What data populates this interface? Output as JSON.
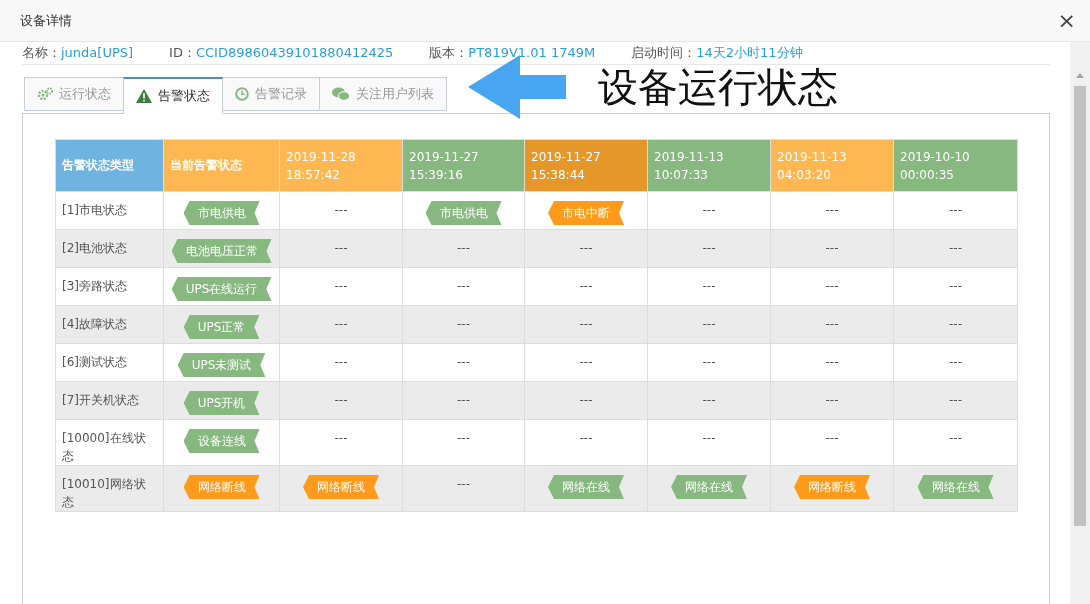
{
  "window": {
    "title": "设备详情",
    "close": "×"
  },
  "info": [
    {
      "label": "名称：",
      "value": "junda[UPS]"
    },
    {
      "label": "ID：",
      "value": "CCID89860439101880412425"
    },
    {
      "label": "版本：",
      "value": "PT819V1.01 1749M"
    },
    {
      "label": "启动时间：",
      "value": "14天2小时11分钟"
    }
  ],
  "tabs": [
    {
      "label": "运行状态",
      "selected": false
    },
    {
      "label": "告警状态",
      "selected": true
    },
    {
      "label": "告警记录",
      "selected": false
    },
    {
      "label": "关注用户列表",
      "selected": false
    }
  ],
  "annotation": {
    "text": "设备运行状态"
  },
  "table": {
    "columns": [
      {
        "label": "告警状态类型",
        "color": "#6fb3e0"
      },
      {
        "label": "当前告警状态",
        "color": "#ffb752"
      },
      {
        "label": "2019-11-28 18:57:42",
        "color": "#ffb752"
      },
      {
        "label": "2019-11-27 15:39:16",
        "color": "#87b87f"
      },
      {
        "label": "2019-11-27 15:38:44",
        "color": "#e59729"
      },
      {
        "label": "2019-11-13 10:07:33",
        "color": "#87b87f"
      },
      {
        "label": "2019-11-13 04:03:20",
        "color": "#ffb752"
      },
      {
        "label": "2019-10-10 00:00:35",
        "color": "#87b87f"
      }
    ],
    "rows": [
      {
        "cells": [
          {
            "kind": "label",
            "text": "[1]市电状态"
          },
          {
            "kind": "tag",
            "text": "市电供电",
            "color": "#87b87f"
          },
          {
            "kind": "text",
            "text": "---"
          },
          {
            "kind": "tag",
            "text": "市电供电",
            "color": "#87b87f"
          },
          {
            "kind": "tag",
            "text": "市电中断",
            "color": "#ff9a1a"
          },
          {
            "kind": "text",
            "text": "---"
          },
          {
            "kind": "text",
            "text": "---"
          },
          {
            "kind": "text",
            "text": "---"
          }
        ]
      },
      {
        "cells": [
          {
            "kind": "label",
            "text": "[2]电池状态"
          },
          {
            "kind": "tag",
            "text": "电池电压正常",
            "color": "#87b87f"
          },
          {
            "kind": "text",
            "text": "---"
          },
          {
            "kind": "text",
            "text": "---"
          },
          {
            "kind": "text",
            "text": "---"
          },
          {
            "kind": "text",
            "text": "---"
          },
          {
            "kind": "text",
            "text": "---"
          },
          {
            "kind": "text",
            "text": "---"
          }
        ]
      },
      {
        "cells": [
          {
            "kind": "label",
            "text": "[3]旁路状态"
          },
          {
            "kind": "tag",
            "text": "UPS在线运行",
            "color": "#87b87f"
          },
          {
            "kind": "text",
            "text": "---"
          },
          {
            "kind": "text",
            "text": "---"
          },
          {
            "kind": "text",
            "text": "---"
          },
          {
            "kind": "text",
            "text": "---"
          },
          {
            "kind": "text",
            "text": "---"
          },
          {
            "kind": "text",
            "text": "---"
          }
        ]
      },
      {
        "cells": [
          {
            "kind": "label",
            "text": "[4]故障状态"
          },
          {
            "kind": "tag",
            "text": "UPS正常",
            "color": "#87b87f"
          },
          {
            "kind": "text",
            "text": "---"
          },
          {
            "kind": "text",
            "text": "---"
          },
          {
            "kind": "text",
            "text": "---"
          },
          {
            "kind": "text",
            "text": "---"
          },
          {
            "kind": "text",
            "text": "---"
          },
          {
            "kind": "text",
            "text": "---"
          }
        ]
      },
      {
        "cells": [
          {
            "kind": "label",
            "text": "[6]测试状态"
          },
          {
            "kind": "tag",
            "text": "UPS未测试",
            "color": "#87b87f"
          },
          {
            "kind": "text",
            "text": "---"
          },
          {
            "kind": "text",
            "text": "---"
          },
          {
            "kind": "text",
            "text": "---"
          },
          {
            "kind": "text",
            "text": "---"
          },
          {
            "kind": "text",
            "text": "---"
          },
          {
            "kind": "text",
            "text": "---"
          }
        ]
      },
      {
        "cells": [
          {
            "kind": "label",
            "text": "[7]开关机状态"
          },
          {
            "kind": "tag",
            "text": "UPS开机",
            "color": "#87b87f"
          },
          {
            "kind": "text",
            "text": "---"
          },
          {
            "kind": "text",
            "text": "---"
          },
          {
            "kind": "text",
            "text": "---"
          },
          {
            "kind": "text",
            "text": "---"
          },
          {
            "kind": "text",
            "text": "---"
          },
          {
            "kind": "text",
            "text": "---"
          }
        ]
      },
      {
        "cells": [
          {
            "kind": "label",
            "text": "[10000]在线状态"
          },
          {
            "kind": "tag",
            "text": "设备连线",
            "color": "#87b87f"
          },
          {
            "kind": "text",
            "text": "---"
          },
          {
            "kind": "text",
            "text": "---"
          },
          {
            "kind": "text",
            "text": "---"
          },
          {
            "kind": "text",
            "text": "---"
          },
          {
            "kind": "text",
            "text": "---"
          },
          {
            "kind": "text",
            "text": "---"
          }
        ]
      },
      {
        "cells": [
          {
            "kind": "label",
            "text": "[10010]网络状态"
          },
          {
            "kind": "tag",
            "text": "网络断线",
            "color": "#ff9a1a"
          },
          {
            "kind": "tag",
            "text": "网络断线",
            "color": "#ff9a1a"
          },
          {
            "kind": "text",
            "text": "---"
          },
          {
            "kind": "tag",
            "text": "网络在线",
            "color": "#87b87f"
          },
          {
            "kind": "tag",
            "text": "网络在线",
            "color": "#87b87f"
          },
          {
            "kind": "tag",
            "text": "网络断线",
            "color": "#ff9a1a"
          },
          {
            "kind": "tag",
            "text": "网络在线",
            "color": "#87b87f"
          }
        ]
      }
    ]
  }
}
